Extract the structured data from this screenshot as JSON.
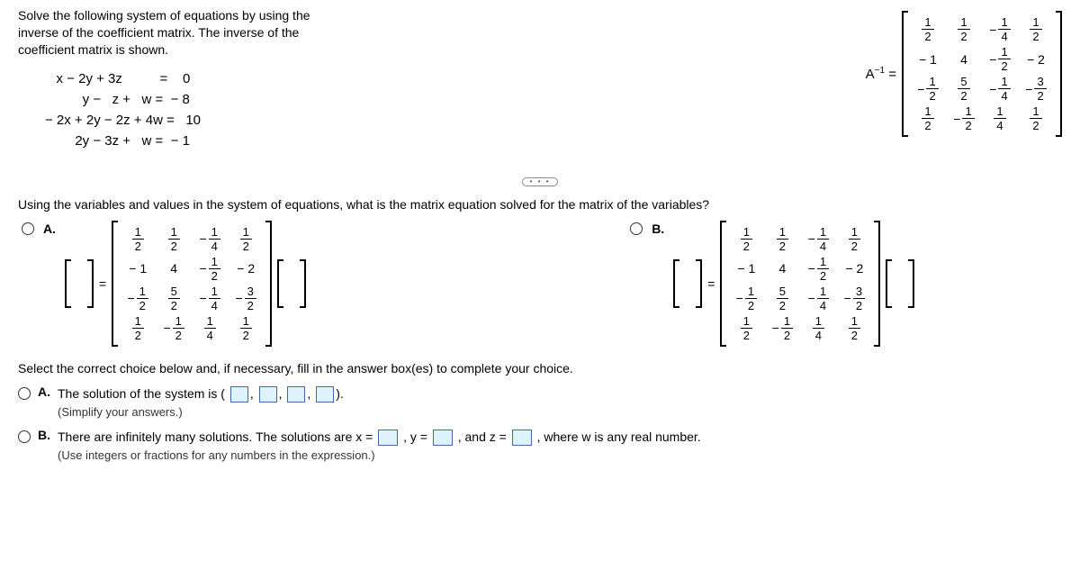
{
  "prompt": "Solve the following system of equations by using the inverse of the coefficient matrix. The inverse of the coefficient matrix is shown.",
  "system": {
    "eq1": "   x − 2y + 3z          =    0",
    "eq2": "          y −   z +   w =  − 8",
    "eq3": "− 2x + 2y − 2z + 4w =   10",
    "eq4": "        2y − 3z +   w =  − 1"
  },
  "inverse_label": "A",
  "inverse_sup": "−1",
  "eq_sign": "=",
  "inverse_matrix": [
    [
      {
        "n": "1",
        "d": "2"
      },
      {
        "n": "1",
        "d": "2"
      },
      {
        "neg": true,
        "n": "1",
        "d": "4"
      },
      {
        "n": "1",
        "d": "2"
      }
    ],
    [
      {
        "v": "− 1"
      },
      {
        "v": "4"
      },
      {
        "neg": true,
        "n": "1",
        "d": "2"
      },
      {
        "v": "− 2"
      }
    ],
    [
      {
        "neg": true,
        "n": "1",
        "d": "2"
      },
      {
        "n": "5",
        "d": "2"
      },
      {
        "neg": true,
        "n": "1",
        "d": "4"
      },
      {
        "neg": true,
        "n": "3",
        "d": "2"
      }
    ],
    [
      {
        "n": "1",
        "d": "2"
      },
      {
        "neg": true,
        "n": "1",
        "d": "2"
      },
      {
        "n": "1",
        "d": "4"
      },
      {
        "n": "1",
        "d": "2"
      }
    ]
  ],
  "ellipsis": "• • •",
  "q1": "Using the variables and values in the system of equations, what is the matrix equation solved for the matrix of the variables?",
  "optA": "A.",
  "optB": "B.",
  "ans_matrix": [
    [
      {
        "n": "1",
        "d": "2"
      },
      {
        "n": "1",
        "d": "2"
      },
      {
        "neg": true,
        "n": "1",
        "d": "4"
      },
      {
        "n": "1",
        "d": "2"
      }
    ],
    [
      {
        "v": "− 1"
      },
      {
        "v": "4"
      },
      {
        "neg": true,
        "n": "1",
        "d": "2"
      },
      {
        "v": "− 2"
      }
    ],
    [
      {
        "neg": true,
        "n": "1",
        "d": "2"
      },
      {
        "n": "5",
        "d": "2"
      },
      {
        "neg": true,
        "n": "1",
        "d": "4"
      },
      {
        "neg": true,
        "n": "3",
        "d": "2"
      }
    ],
    [
      {
        "n": "1",
        "d": "2"
      },
      {
        "neg": true,
        "n": "1",
        "d": "2"
      },
      {
        "n": "1",
        "d": "4"
      },
      {
        "n": "1",
        "d": "2"
      }
    ]
  ],
  "select_prompt": "Select the correct choice below and, if necessary, fill in the answer box(es) to complete your choice.",
  "choiceA": {
    "label": "A.",
    "text1": "The solution of the system is (",
    "text2": ").",
    "hint": "(Simplify your answers.)"
  },
  "choiceB": {
    "label": "B.",
    "text1": "There are infinitely many solutions. The solutions are x =",
    "text2": ", y =",
    "text3": ", and z =",
    "text4": ", where w is any real number.",
    "hint": "(Use integers or fractions for any numbers in the expression.)"
  },
  "comma": ","
}
